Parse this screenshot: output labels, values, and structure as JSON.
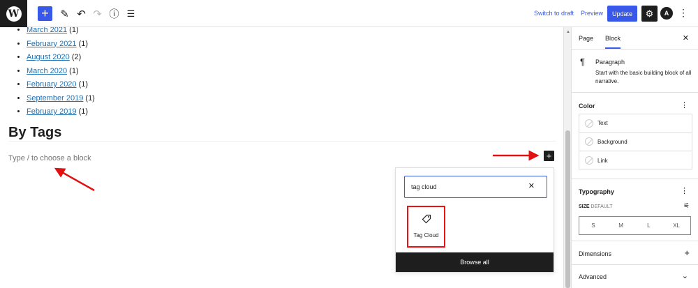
{
  "toolbar": {
    "add_icon": "plus-icon",
    "switch_to_draft": "Switch to draft",
    "preview": "Preview",
    "update": "Update"
  },
  "editor": {
    "archives": [
      {
        "month": "March 2021",
        "count": "(1)"
      },
      {
        "month": "February 2021",
        "count": "(1)"
      },
      {
        "month": "August 2020",
        "count": "(2)"
      },
      {
        "month": "March 2020",
        "count": "(1)"
      },
      {
        "month": "February 2020",
        "count": "(1)"
      },
      {
        "month": "September 2019",
        "count": "(1)"
      },
      {
        "month": "February 2019",
        "count": "(1)"
      }
    ],
    "heading": "By Tags",
    "placeholder": "Type / to choose a block"
  },
  "inserter": {
    "search_value": "tag cloud",
    "result_label": "Tag Cloud",
    "result_icon": "tag-icon",
    "browse_all": "Browse all"
  },
  "sidebar": {
    "tabs": [
      "Page",
      "Block"
    ],
    "active_tab": "Block",
    "block_title": "Paragraph",
    "block_description": "Start with the basic building block of all narrative.",
    "color_panel": "Color",
    "color_options": [
      "Text",
      "Background",
      "Link"
    ],
    "typography_panel": "Typography",
    "size_label": "SIZE",
    "size_value": "DEFAULT",
    "size_options": [
      "S",
      "M",
      "L",
      "XL"
    ],
    "dimensions_panel": "Dimensions",
    "advanced_panel": "Advanced"
  },
  "colors": {
    "accent": "#3858e9",
    "annotation_red": "#e11111",
    "dark": "#1e1e1e",
    "link": "#2271b1"
  }
}
